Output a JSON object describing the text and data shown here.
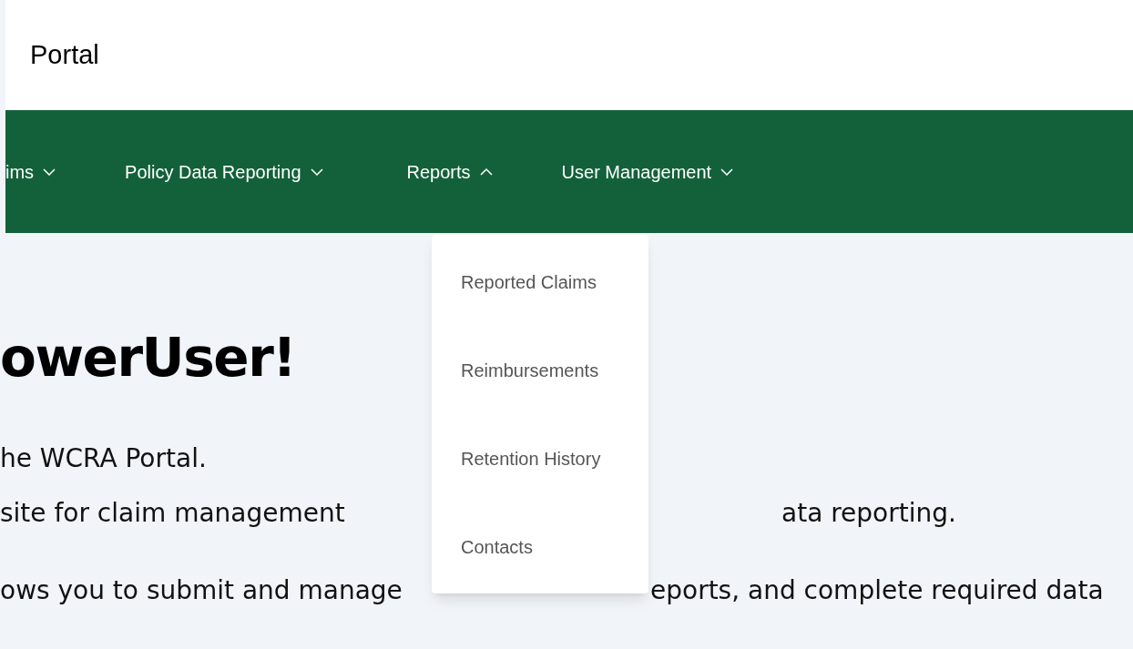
{
  "header": {
    "title": "Portal"
  },
  "nav": [
    {
      "label": "ims",
      "expanded": false
    },
    {
      "label": "Policy Data Reporting",
      "expanded": false
    },
    {
      "label": "Reports",
      "expanded": true
    },
    {
      "label": "User Management",
      "expanded": false
    }
  ],
  "dropdown": {
    "items": [
      "Reported Claims",
      "Reimbursements",
      "Retention History",
      "Contacts"
    ]
  },
  "greeting": "owerUser!",
  "lines": [
    {
      "left": "he WCRA Portal."
    },
    {
      "left": "site for claim management",
      "right": "ata reporting."
    },
    {
      "left": "ows you to submit and manage",
      "right": "eports, and complete required data"
    }
  ]
}
